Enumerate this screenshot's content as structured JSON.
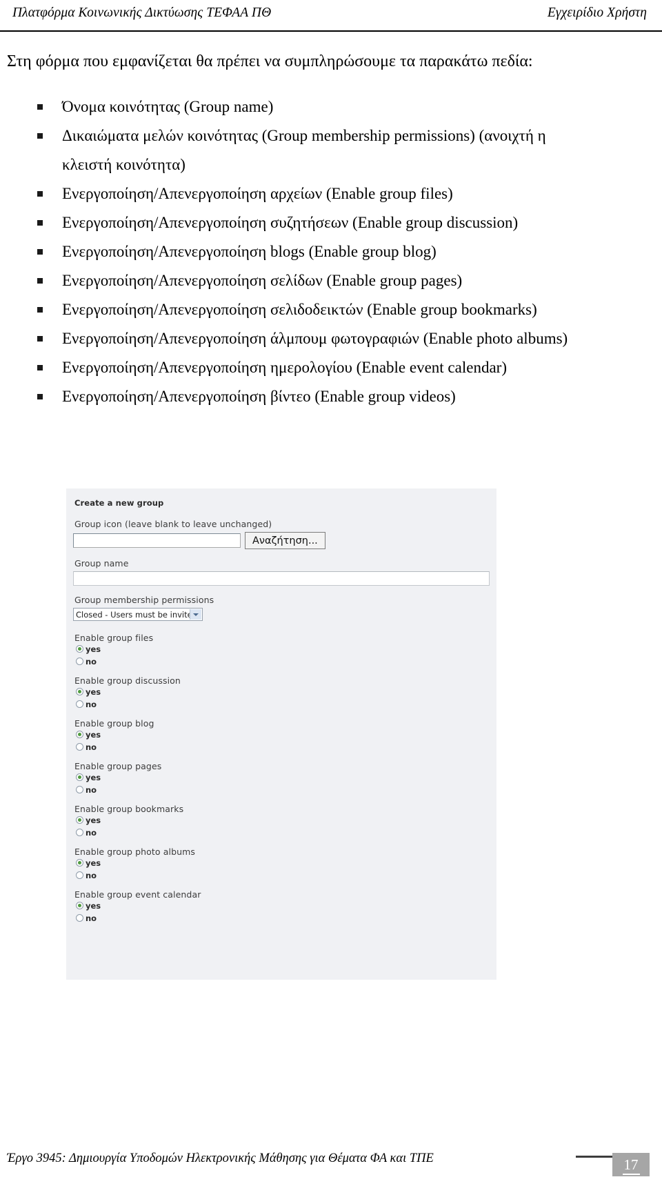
{
  "header": {
    "left": "Πλατφόρμα Κοινωνικής Δικτύωσης ΤΕΦΑΑ ΠΘ",
    "right": "Εγχειρίδιο Χρήστη"
  },
  "body": {
    "intro": "Στη φόρμα που εμφανίζεται θα πρέπει να συμπληρώσουμε τα παρακάτω πεδία:",
    "bullets": [
      "Όνομα κοινότητας (Group name)",
      "Δικαιώματα μελών κοινότητας (Group membership permissions) (ανοιχτή η κλειστή κοινότητα)",
      "Ενεργοποίηση/Απενεργοποίηση αρχείων (Enable group files)",
      "Ενεργοποίηση/Απενεργοποίηση συζητήσεων (Enable group discussion)",
      "Ενεργοποίηση/Απενεργοποίηση blogs (Enable group blog)",
      "Ενεργοποίηση/Απενεργοποίηση σελίδων (Enable group pages)",
      "Ενεργοποίηση/Απενεργοποίηση σελιδοδεικτών (Enable group bookmarks)",
      "Ενεργοποίηση/Απενεργοποίηση άλμπουμ φωτογραφιών (Enable photo albums)",
      "Ενεργοποίηση/Απενεργοποίηση ημερολογίου (Enable event calendar)",
      "Ενεργοποίηση/Απενεργοποίηση βίντεο (Enable group videos)"
    ]
  },
  "screenshot": {
    "title": "Create a new group",
    "group_icon": {
      "label": "Group icon (leave blank to leave unchanged)",
      "value": "",
      "browse_label": "Αναζήτηση..."
    },
    "group_name": {
      "label": "Group name",
      "value": ""
    },
    "membership_permissions": {
      "label": "Group membership permissions",
      "selected": "Closed - Users must be invited"
    },
    "radio_yes": "yes",
    "radio_no": "no",
    "toggles": [
      {
        "label": "Enable group files",
        "selected": "yes"
      },
      {
        "label": "Enable group discussion",
        "selected": "yes"
      },
      {
        "label": "Enable group blog",
        "selected": "yes"
      },
      {
        "label": "Enable group pages",
        "selected": "yes"
      },
      {
        "label": "Enable group bookmarks",
        "selected": "yes"
      },
      {
        "label": "Enable group photo albums",
        "selected": "yes"
      },
      {
        "label": "Enable group event calendar",
        "selected": "yes"
      }
    ],
    "accent_selected_color": "#4f9a3f"
  },
  "footer": {
    "text": "Έργο 3945: Δημιουργία Υποδομών Ηλεκτρονικής Μάθησης για Θέματα ΦΑ και ΤΠΕ",
    "page_number": "17"
  }
}
